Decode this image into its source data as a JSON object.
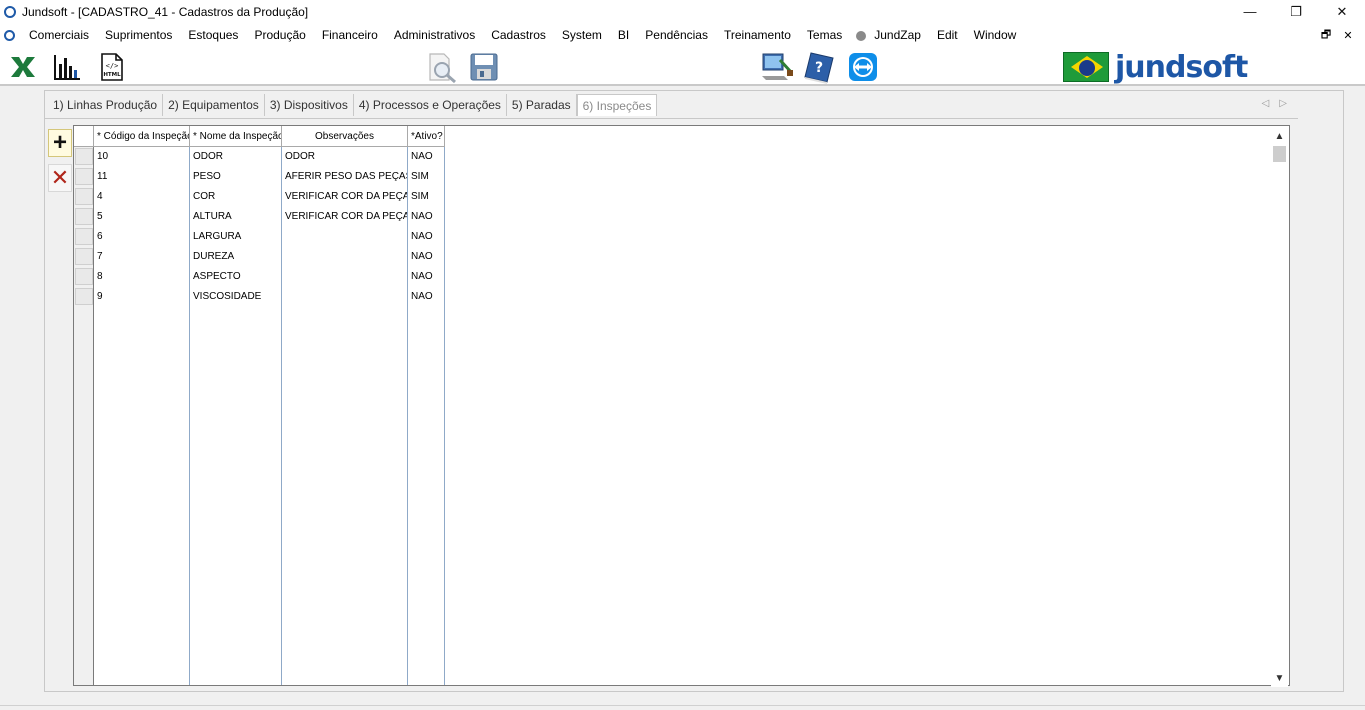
{
  "window": {
    "title": "Jundsoft - [CADASTRO_41 - Cadastros da Produção]",
    "minimize": "—",
    "restore": "❐",
    "close": "✕"
  },
  "menu": {
    "items": [
      "Comerciais",
      "Suprimentos",
      "Estoques",
      "Produção",
      "Financeiro",
      "Administrativos",
      "Cadastros",
      "System",
      "BI",
      "Pendências",
      "Treinamento",
      "Temas"
    ],
    "jundzap": "JundZap",
    "edit": "Edit",
    "window_label": "Window",
    "mdi_restore": "🗗",
    "mdi_close": "✕"
  },
  "toolbar": {
    "icons": [
      "excel-icon",
      "bar-chart-icon",
      "html-export-icon",
      "print-preview-icon",
      "save-icon",
      "remote-support-icon",
      "help-book-icon",
      "teamviewer-icon"
    ]
  },
  "logo": {
    "text": "jundsoft"
  },
  "tabs": [
    {
      "label": "1) Linhas Produção",
      "active": false
    },
    {
      "label": "2) Equipamentos",
      "active": false
    },
    {
      "label": "3) Dispositivos",
      "active": false
    },
    {
      "label": "4) Processos e Operações",
      "active": false
    },
    {
      "label": "5) Paradas",
      "active": false
    },
    {
      "label": "6) Inspeções",
      "active": true
    }
  ],
  "tab_scroll": {
    "left": "◁",
    "right": "▷"
  },
  "side_buttons": {
    "add": "+",
    "delete": "✕"
  },
  "grid": {
    "columns": [
      {
        "label": "* Código da Inspeção"
      },
      {
        "label": "* Nome da Inspeção"
      },
      {
        "label": "Observações"
      },
      {
        "label": "*Ativo?"
      }
    ],
    "rows": [
      {
        "codigo": "10",
        "nome": "ODOR",
        "obs": "ODOR",
        "ativo": "NAO"
      },
      {
        "codigo": "11",
        "nome": "PESO",
        "obs": "AFERIR PESO DAS PEÇAS",
        "ativo": "SIM"
      },
      {
        "codigo": "4",
        "nome": "COR",
        "obs": "VERIFICAR COR DA PEÇA",
        "ativo": "SIM"
      },
      {
        "codigo": "5",
        "nome": "ALTURA",
        "obs": "VERIFICAR COR DA PEÇA",
        "ativo": "NAO"
      },
      {
        "codigo": "6",
        "nome": "LARGURA",
        "obs": "",
        "ativo": "NAO"
      },
      {
        "codigo": "7",
        "nome": "DUREZA",
        "obs": "",
        "ativo": "NAO"
      },
      {
        "codigo": "8",
        "nome": "ASPECTO",
        "obs": "",
        "ativo": "NAO"
      },
      {
        "codigo": "9",
        "nome": "VISCOSIDADE",
        "obs": "",
        "ativo": "NAO"
      }
    ]
  },
  "scrollbar": {
    "up": "▲",
    "down": "▼"
  }
}
